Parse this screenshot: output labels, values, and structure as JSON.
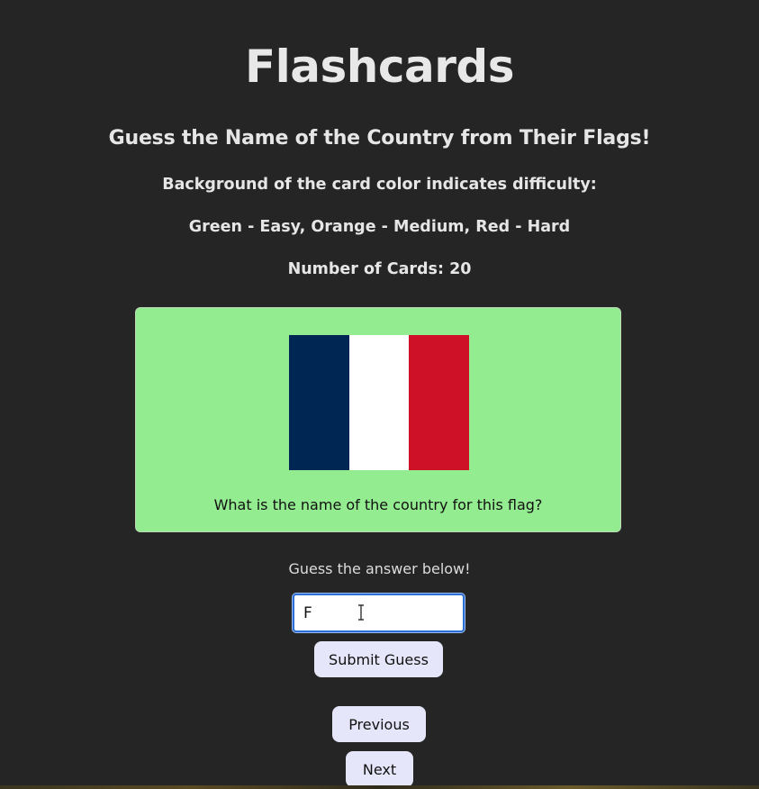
{
  "header": {
    "title": "Flashcards",
    "subtitle": "Guess the Name of the Country from Their Flags!",
    "difficulty_note": "Background of the card color indicates difficulty:",
    "difficulty_legend": "Green - Easy, Orange - Medium, Red - Hard",
    "card_count": "Number of Cards: 20"
  },
  "card": {
    "background_color": "#93ec8f",
    "flag_colors": [
      "#002654",
      "#ffffff",
      "#ce1126"
    ],
    "question": "What is the name of the country for this flag?"
  },
  "guess": {
    "hint": "Guess the answer below!",
    "input_value": "F",
    "submit_label": "Submit Guess"
  },
  "navigation": {
    "previous_label": "Previous",
    "next_label": "Next"
  },
  "colors": {
    "page_background": "#252525",
    "button_background": "#e6e6fa",
    "input_focus": "#2a6fd6"
  }
}
